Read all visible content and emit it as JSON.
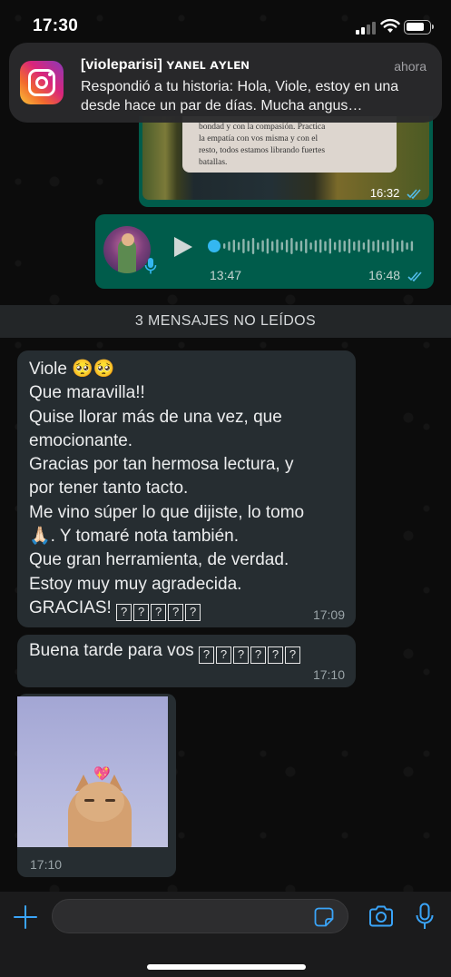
{
  "status_bar": {
    "time": "17:30"
  },
  "notification": {
    "app_icon": "instagram-icon",
    "title": "[violeparisi] ʏᴀɴᴇʟ ᴀʏʟᴇɴ",
    "time": "ahora",
    "body": "Respondió a tu historia: Hola, Viole, estoy en una desde hace un par de días. Mucha angus…"
  },
  "chat": {
    "outgoing_image": {
      "photo_text_lines": [
        "bondad y con la compasión. Practica",
        "la empatía con vos misma y con el",
        "resto, todos estamos librando fuertes",
        "batallas."
      ],
      "time": "16:32"
    },
    "voice_message": {
      "duration": "13:47",
      "time": "16:48",
      "played_fraction": 0.0
    },
    "unread_banner": "3 MENSAJES NO LEÍDOS",
    "messages": [
      {
        "lines": [
          "Viole 🥺🥺",
          "Que maravilla!!",
          "Quise llorar más de una vez, que",
          "emocionante.",
          "Gracias por tan hermosa lectura, y",
          "por tener tanto tacto.",
          "Me vino súper lo que dijiste, lo tomo",
          "🙏🏻. Y tomaré nota también.",
          "Que gran herramienta, de verdad.",
          "Estoy muy muy agradecida.",
          "GRACIAS!"
        ],
        "trailing_glyph_count": 5,
        "time": "17:09"
      },
      {
        "text": "Buena tarde para vos",
        "trailing_glyph_count": 6,
        "time": "17:10"
      }
    ],
    "image_message": {
      "time": "17:10"
    }
  },
  "input_bar": {
    "value": "",
    "placeholder": ""
  },
  "colors": {
    "outgoing_bubble": "#005c4b",
    "incoming_bubble": "#262d31",
    "accent_blue": "#3aa4f8",
    "read_ticks": "#53bdeb"
  }
}
